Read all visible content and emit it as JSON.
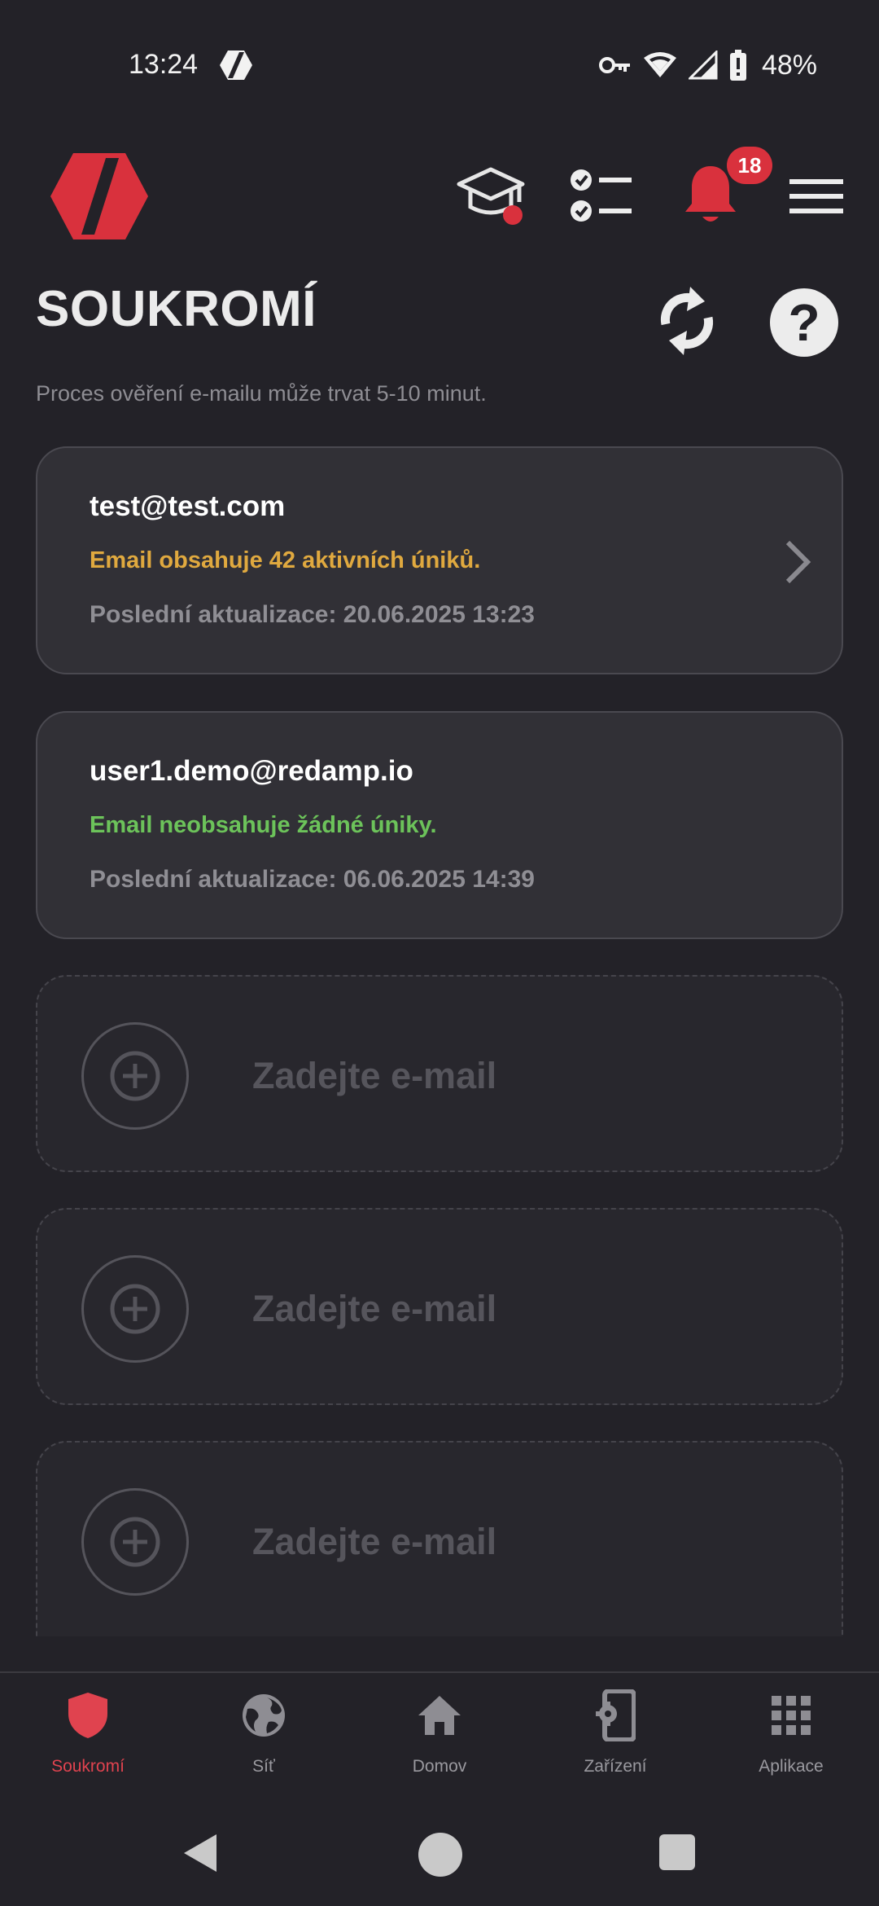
{
  "status_bar": {
    "time": "13:24",
    "battery": "48%"
  },
  "header": {
    "notification_count": "18"
  },
  "page": {
    "title": "SOUKROMÍ",
    "subtitle": "Proces ověření e-mailu může trvat 5-10 minut."
  },
  "emails": [
    {
      "address": "test@test.com",
      "status": "Email obsahuje 42 aktivních úniků.",
      "status_type": "warning",
      "updated": "Poslední aktualizace: 20.06.2025 13:23"
    },
    {
      "address": "user1.demo@redamp.io",
      "status": "Email neobsahuje žádné úniky.",
      "status_type": "ok",
      "updated": "Poslední aktualizace: 06.06.2025 14:39"
    }
  ],
  "add_slots": [
    {
      "placeholder": "Zadejte e-mail"
    },
    {
      "placeholder": "Zadejte e-mail"
    },
    {
      "placeholder": "Zadejte e-mail"
    }
  ],
  "bottom_nav": [
    {
      "label": "Soukromí",
      "icon": "shield-icon",
      "active": true
    },
    {
      "label": "Síť",
      "icon": "globe-icon",
      "active": false
    },
    {
      "label": "Domov",
      "icon": "home-icon",
      "active": false
    },
    {
      "label": "Zařízení",
      "icon": "device-settings-icon",
      "active": false
    },
    {
      "label": "Aplikace",
      "icon": "apps-grid-icon",
      "active": false
    }
  ],
  "colors": {
    "background": "#232228",
    "accent": "#d9313d",
    "warning": "#e0a93f",
    "ok": "#6cc35a"
  }
}
